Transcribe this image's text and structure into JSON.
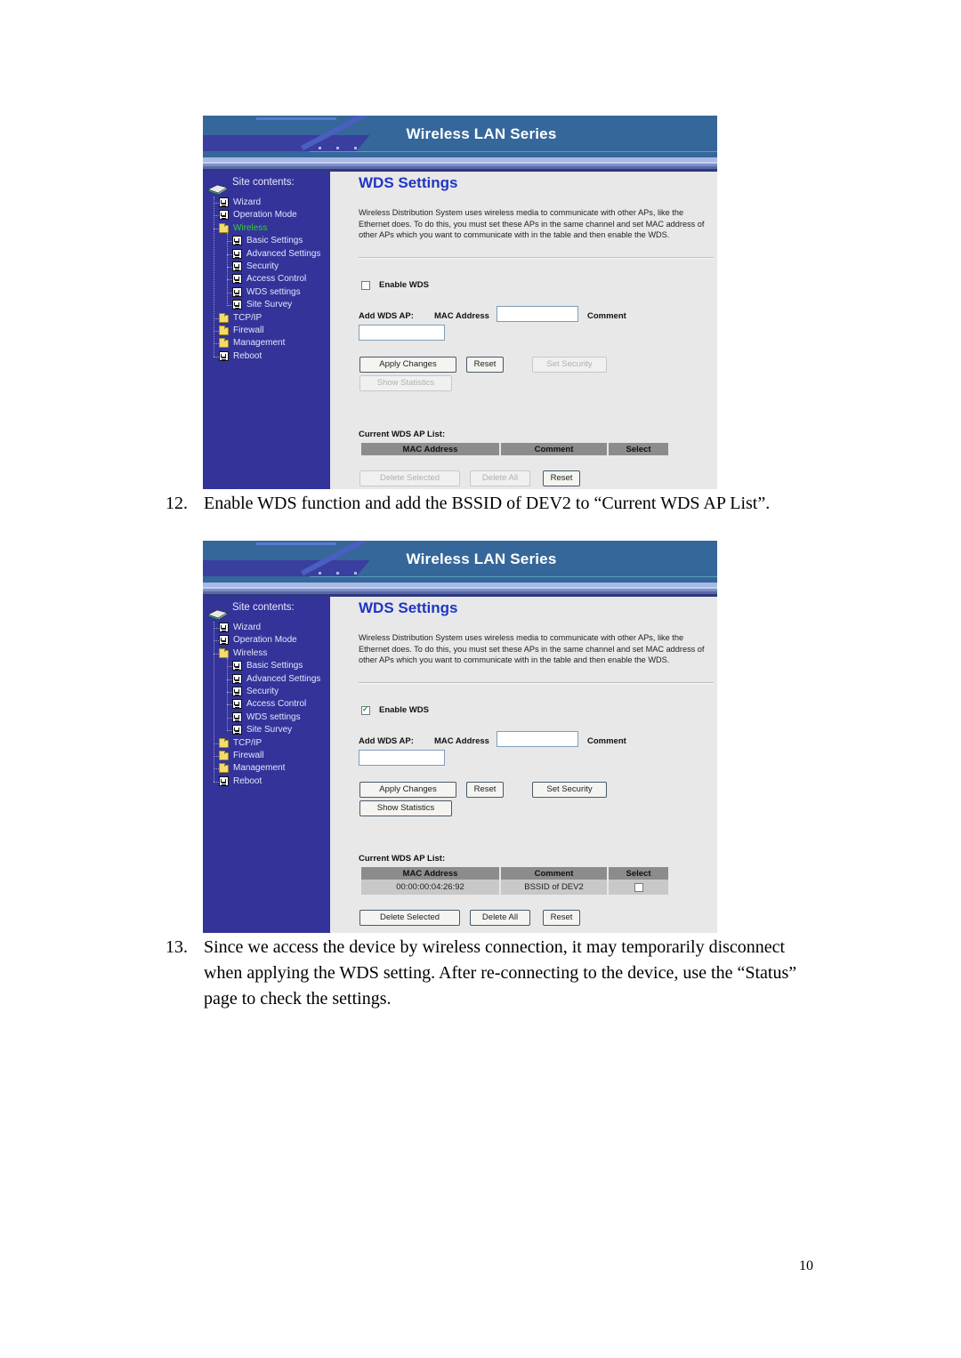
{
  "screenshots": [
    {
      "banner_title": "Wireless LAN Series",
      "sidebar": {
        "heading": "Site contents:",
        "items": [
          {
            "label": "Wizard",
            "icon": "page-icon",
            "level": 0,
            "active": false
          },
          {
            "label": "Operation Mode",
            "icon": "page-icon",
            "level": 0,
            "active": false
          },
          {
            "label": "Wireless",
            "icon": "open-folder-icon",
            "level": 0,
            "active": true
          },
          {
            "label": "Basic Settings",
            "icon": "page-icon",
            "level": 1,
            "active": false
          },
          {
            "label": "Advanced Settings",
            "icon": "page-icon",
            "level": 1,
            "active": false
          },
          {
            "label": "Security",
            "icon": "page-icon",
            "level": 1,
            "active": false
          },
          {
            "label": "Access Control",
            "icon": "page-icon",
            "level": 1,
            "active": false
          },
          {
            "label": "WDS settings",
            "icon": "page-icon",
            "level": 1,
            "active": false
          },
          {
            "label": "Site Survey",
            "icon": "page-icon",
            "level": 1,
            "active": false
          },
          {
            "label": "TCP/IP",
            "icon": "folder-icon",
            "level": 0,
            "active": false
          },
          {
            "label": "Firewall",
            "icon": "folder-icon",
            "level": 0,
            "active": false
          },
          {
            "label": "Management",
            "icon": "folder-icon",
            "level": 0,
            "active": false
          },
          {
            "label": "Reboot",
            "icon": "page-icon",
            "level": 0,
            "active": false
          }
        ]
      },
      "title": "WDS Settings",
      "description": "Wireless Distribution System uses wireless media to communicate with other APs, like the Ethernet does. To do this, you must set these APs in the same channel and set MAC address of other APs which you want to communicate with in the table and then enable the WDS.",
      "enable_wds": {
        "label": "Enable WDS",
        "checked": false
      },
      "add_wds_ap": {
        "label": "Add WDS AP:",
        "mac_label": "MAC Address",
        "mac_value": "",
        "comment_label": "Comment",
        "comment_value": ""
      },
      "buttons": {
        "apply": {
          "label": "Apply Changes",
          "enabled": true
        },
        "reset": {
          "label": "Reset",
          "enabled": true
        },
        "set_security": {
          "label": "Set Security",
          "enabled": false
        },
        "show_statistics": {
          "label": "Show Statistics",
          "enabled": false
        }
      },
      "list": {
        "label": "Current WDS AP List:",
        "columns": [
          "MAC Address",
          "Comment",
          "Select"
        ],
        "rows": []
      },
      "list_buttons": {
        "delete_selected": {
          "label": "Delete Selected",
          "enabled": false
        },
        "delete_all": {
          "label": "Delete All",
          "enabled": false
        },
        "reset": {
          "label": "Reset",
          "enabled": true
        }
      }
    },
    {
      "banner_title": "Wireless LAN Series",
      "sidebar": {
        "heading": "Site contents:",
        "items": [
          {
            "label": "Wizard",
            "icon": "page-icon",
            "level": 0,
            "active": false
          },
          {
            "label": "Operation Mode",
            "icon": "page-icon",
            "level": 0,
            "active": false
          },
          {
            "label": "Wireless",
            "icon": "open-folder-icon",
            "level": 0,
            "active": false
          },
          {
            "label": "Basic Settings",
            "icon": "page-icon",
            "level": 1,
            "active": false
          },
          {
            "label": "Advanced Settings",
            "icon": "page-icon",
            "level": 1,
            "active": false
          },
          {
            "label": "Security",
            "icon": "page-icon",
            "level": 1,
            "active": false
          },
          {
            "label": "Access Control",
            "icon": "page-icon",
            "level": 1,
            "active": false
          },
          {
            "label": "WDS settings",
            "icon": "page-icon",
            "level": 1,
            "active": false
          },
          {
            "label": "Site Survey",
            "icon": "page-icon",
            "level": 1,
            "active": false
          },
          {
            "label": "TCP/IP",
            "icon": "folder-icon",
            "level": 0,
            "active": false
          },
          {
            "label": "Firewall",
            "icon": "folder-icon",
            "level": 0,
            "active": false
          },
          {
            "label": "Management",
            "icon": "folder-icon",
            "level": 0,
            "active": false
          },
          {
            "label": "Reboot",
            "icon": "page-icon",
            "level": 0,
            "active": false
          }
        ]
      },
      "title": "WDS Settings",
      "description": "Wireless Distribution System uses wireless media to communicate with other APs, like the Ethernet does. To do this, you must set these APs in the same channel and set MAC address of other APs which you want to communicate with in the table and then enable the WDS.",
      "enable_wds": {
        "label": "Enable WDS",
        "checked": true
      },
      "add_wds_ap": {
        "label": "Add WDS AP:",
        "mac_label": "MAC Address",
        "mac_value": "",
        "comment_label": "Comment",
        "comment_value": ""
      },
      "buttons": {
        "apply": {
          "label": "Apply Changes",
          "enabled": true
        },
        "reset": {
          "label": "Reset",
          "enabled": true
        },
        "set_security": {
          "label": "Set Security",
          "enabled": true
        },
        "show_statistics": {
          "label": "Show Statistics",
          "enabled": true
        }
      },
      "list": {
        "label": "Current WDS AP List:",
        "columns": [
          "MAC Address",
          "Comment",
          "Select"
        ],
        "rows": [
          {
            "mac": "00:00:00:04:26:92",
            "comment": "BSSID of DEV2",
            "selected": false
          }
        ]
      },
      "list_buttons": {
        "delete_selected": {
          "label": "Delete Selected",
          "enabled": true
        },
        "delete_all": {
          "label": "Delete All",
          "enabled": true
        },
        "reset": {
          "label": "Reset",
          "enabled": true
        }
      }
    }
  ],
  "steps": [
    {
      "number": "12.",
      "text": "Enable WDS function and add the BSSID of DEV2 to “Current WDS AP List”."
    },
    {
      "number": "13.",
      "text": "Since we access the device by wireless connection, it may temporarily disconnect when applying the WDS setting. After re-connecting to the device, use the “Status” page to check the settings."
    }
  ],
  "page_number": "10"
}
